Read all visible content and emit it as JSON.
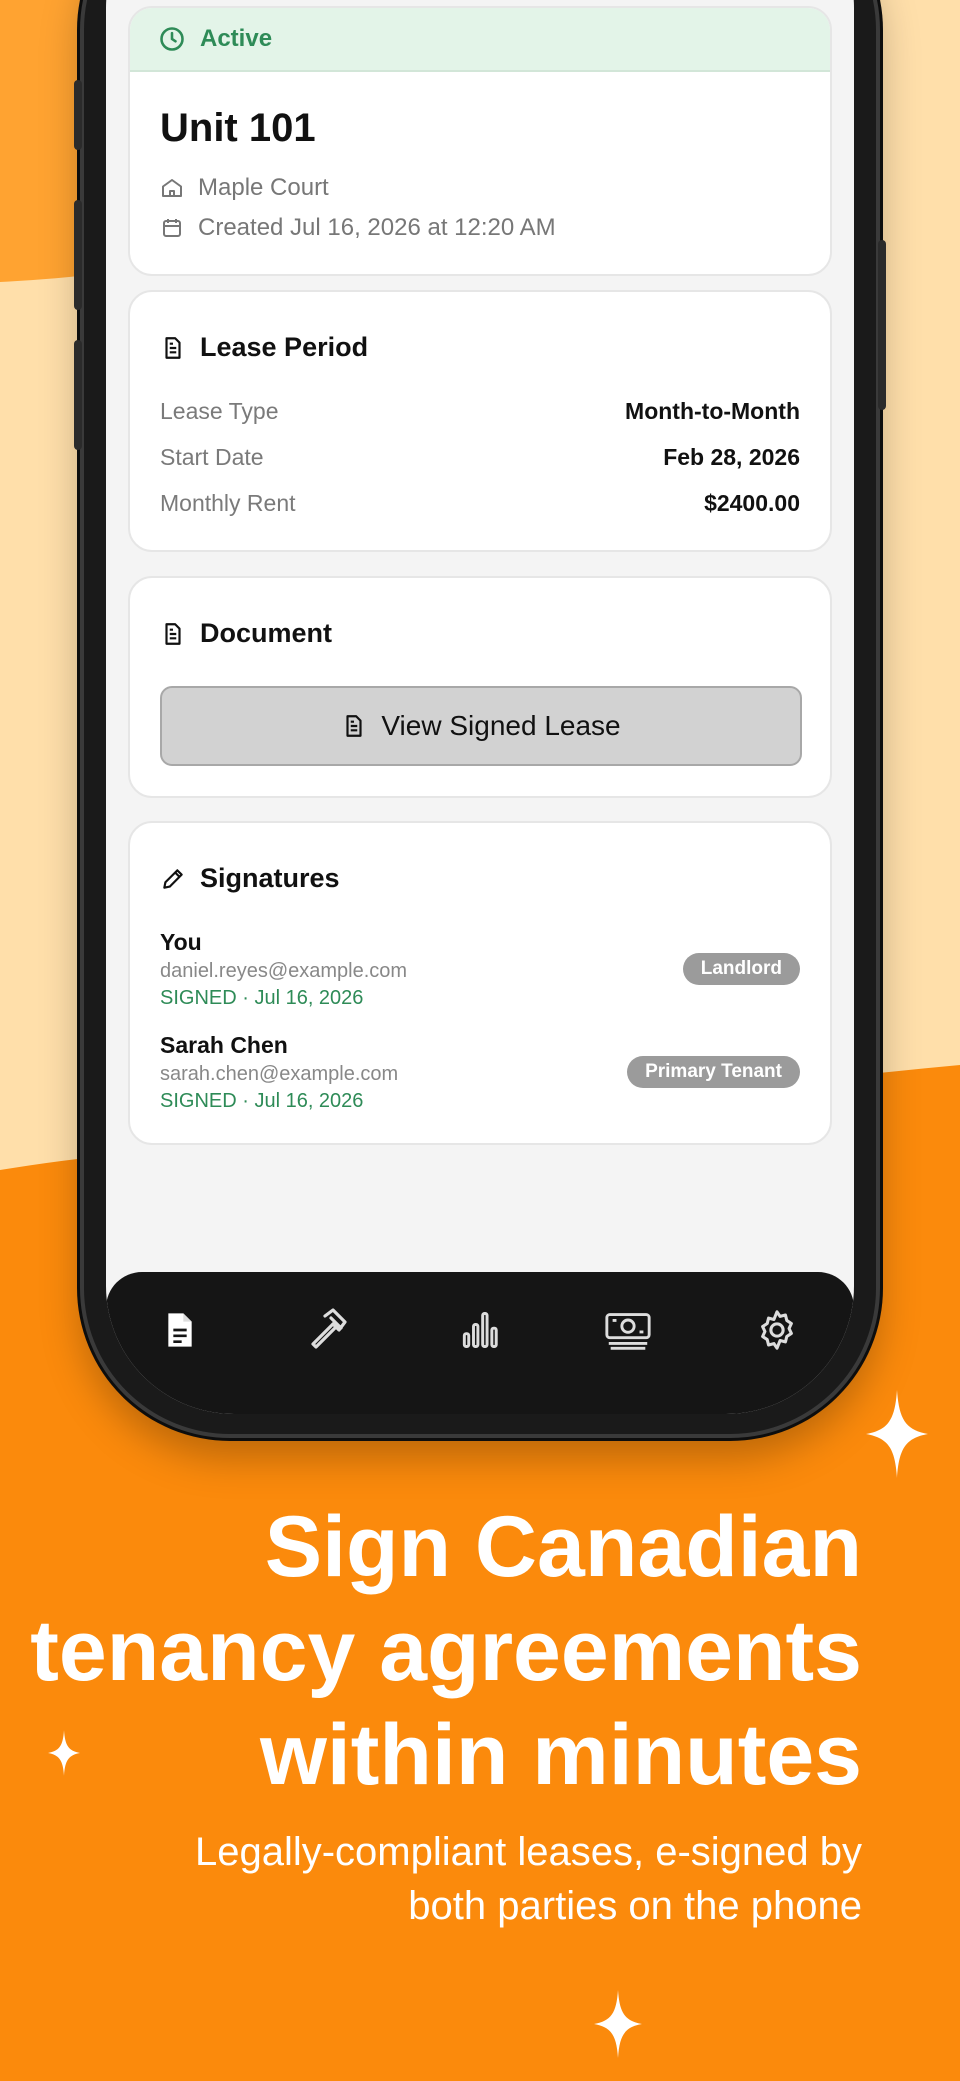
{
  "colors": {
    "background_orange": "#FB8A0C",
    "light_orange": "#FFDFAA",
    "accent_orange": "#FFA331",
    "success_green": "#2E8B57",
    "tabbar_dark": "#151515"
  },
  "status": {
    "label": "Active",
    "icon": "clock-icon"
  },
  "unit": {
    "title": "Unit 101",
    "property": "Maple Court",
    "created": "Created Jul 16, 2026 at 12:20 AM"
  },
  "lease_period": {
    "heading": "Lease Period",
    "rows": [
      {
        "key": "Lease Type",
        "value": "Month-to-Month"
      },
      {
        "key": "Start Date",
        "value": "Feb 28, 2026"
      },
      {
        "key": "Monthly Rent",
        "value": "$2400.00"
      }
    ]
  },
  "document": {
    "heading": "Document",
    "button_label": "View Signed Lease"
  },
  "signatures": {
    "heading": "Signatures",
    "items": [
      {
        "name": "You",
        "email": "daniel.reyes@example.com",
        "status": "SIGNED · Jul 16, 2026",
        "role": "Landlord"
      },
      {
        "name": "Sarah Chen",
        "email": "sarah.chen@example.com",
        "status": "SIGNED · Jul 16, 2026",
        "role": "Primary Tenant"
      }
    ]
  },
  "tabbar": {
    "tabs": [
      "document-icon",
      "hammer-icon",
      "bar-chart-icon",
      "cash-icon",
      "gear-icon"
    ],
    "active_index": 0
  },
  "marketing": {
    "headline_lines": [
      "Sign Canadian",
      "tenancy agreements",
      "within minutes"
    ],
    "subline_lines": [
      "Legally-compliant leases, e-signed by",
      "both parties on the phone"
    ]
  }
}
